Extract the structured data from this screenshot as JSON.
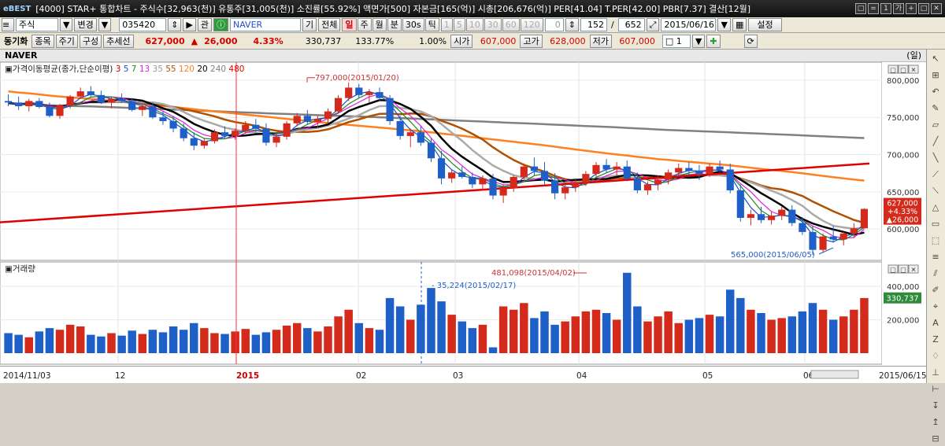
{
  "window": {
    "title": "[4000] STAR+ 통합차트 - 주식수[32,963(천)] 유통주[31,005(천)] 소진률[55.92%] 액면가[500] 자본금[165(억)] 시총[206,676(억)] PER[41.04] T.PER[42.00] PBR[7.37] 결산[12월]",
    "logo": "eBEST",
    "buttons": [
      "□",
      "=",
      "1",
      "가",
      "+",
      "□",
      "✕"
    ]
  },
  "toolbar1": {
    "market": "주식",
    "change": "변경",
    "code": "035420",
    "name": "NAVER",
    "btn_ki": "기",
    "btn_all": "전체",
    "periods": [
      "일",
      "주",
      "월",
      "분",
      "30s",
      "틱"
    ],
    "selected_period": "일",
    "ticks": [
      "1",
      "5",
      "10",
      "30",
      "60",
      "120"
    ],
    "spin_value": "0",
    "count1": "152",
    "count2": "652",
    "date": "2015/06/16",
    "settings": "설정"
  },
  "toolbar2": {
    "sync": "동기화",
    "item": "종목",
    "cycle": "주기",
    "compose": "구성",
    "trend": "추세선",
    "price": "627,000",
    "change_arrow": "▲",
    "change": "26,000",
    "pct": "4.33%",
    "volume": "330,737",
    "vol_ratio": "133.77%",
    "pct2": "1.00%",
    "open_label": "시가",
    "open": "607,000",
    "high_label": "고가",
    "high": "628,000",
    "low_label": "저가",
    "low": "607,000",
    "lines": "1"
  },
  "stock": {
    "name": "NAVER",
    "unit": "(일)"
  },
  "price_panel": {
    "legend_title": "가격이동평균(종가,단순이평)",
    "ma_periods": [
      {
        "p": "3",
        "color": "#d40000"
      },
      {
        "p": "5",
        "color": "#1a4fd8"
      },
      {
        "p": "7",
        "color": "#1a8a1a"
      },
      {
        "p": "13",
        "color": "#e020e0"
      },
      {
        "p": "35",
        "color": "#999999"
      },
      {
        "p": "55",
        "color": "#b05000"
      },
      {
        "p": "120",
        "color": "#ff8020"
      },
      {
        "p": "20",
        "color": "#000000"
      },
      {
        "p": "240",
        "color": "#808080"
      },
      {
        "p": "480",
        "color": "#e00000"
      }
    ],
    "y_ticks": [
      "800,000",
      "750,000",
      "700,000",
      "650,000",
      "600,000"
    ],
    "annot_high": "797,000(2015/01/20)",
    "annot_low": "565,000(2015/06/05)",
    "current_tag": [
      "627,000",
      "+4.33%",
      "▲26,000"
    ]
  },
  "volume_panel": {
    "title": "거래량",
    "y_ticks": [
      "400,000",
      "200,000"
    ],
    "annot_high": "481,098(2015/04/02)",
    "annot_low": "35,224(2015/02/17)",
    "current_tag": "330,737"
  },
  "x_axis": {
    "labels": [
      "2014/11/03",
      "12",
      "2015",
      "02",
      "03",
      "04",
      "05",
      "06",
      "2015/06/15"
    ]
  },
  "colors": {
    "up": "#d42a1c",
    "down": "#1e5fc8",
    "crosshair": "#ff3030"
  },
  "chart_data": {
    "type": "bar",
    "title": "NAVER",
    "xlabel": "",
    "ylabel": "",
    "price_ylim": [
      560000,
      820000
    ],
    "volume_ylim": [
      0,
      480000
    ],
    "candles": [
      [
        772,
        781,
        765,
        770
      ],
      [
        770,
        778,
        760,
        765
      ],
      [
        765,
        775,
        758,
        772
      ],
      [
        772,
        776,
        762,
        764
      ],
      [
        764,
        770,
        750,
        752
      ],
      [
        752,
        768,
        748,
        766
      ],
      [
        766,
        780,
        762,
        778
      ],
      [
        778,
        790,
        775,
        785
      ],
      [
        785,
        792,
        778,
        780
      ],
      [
        780,
        786,
        768,
        770
      ],
      [
        770,
        778,
        762,
        775
      ],
      [
        775,
        782,
        770,
        772
      ],
      [
        772,
        776,
        758,
        760
      ],
      [
        760,
        768,
        752,
        765
      ],
      [
        765,
        770,
        748,
        750
      ],
      [
        750,
        758,
        740,
        745
      ],
      [
        745,
        752,
        730,
        735
      ],
      [
        735,
        742,
        718,
        722
      ],
      [
        722,
        730,
        706,
        712
      ],
      [
        712,
        722,
        708,
        718
      ],
      [
        718,
        734,
        715,
        730
      ],
      [
        730,
        738,
        722,
        725
      ],
      [
        725,
        735,
        720,
        732
      ],
      [
        732,
        745,
        728,
        740
      ],
      [
        740,
        748,
        730,
        735
      ],
      [
        735,
        742,
        712,
        716
      ],
      [
        716,
        728,
        710,
        724
      ],
      [
        724,
        745,
        720,
        742
      ],
      [
        742,
        756,
        738,
        752
      ],
      [
        752,
        760,
        740,
        744
      ],
      [
        744,
        752,
        736,
        748
      ],
      [
        748,
        762,
        742,
        758
      ],
      [
        758,
        780,
        755,
        776
      ],
      [
        776,
        797,
        772,
        790
      ],
      [
        790,
        795,
        776,
        780
      ],
      [
        780,
        788,
        770,
        784
      ],
      [
        784,
        790,
        772,
        776
      ],
      [
        776,
        780,
        740,
        745
      ],
      [
        745,
        752,
        720,
        725
      ],
      [
        725,
        735,
        710,
        730
      ],
      [
        730,
        738,
        712,
        716
      ],
      [
        716,
        722,
        690,
        695
      ],
      [
        695,
        705,
        660,
        668
      ],
      [
        668,
        680,
        662,
        676
      ],
      [
        676,
        684,
        668,
        670
      ],
      [
        670,
        676,
        655,
        660
      ],
      [
        660,
        672,
        652,
        668
      ],
      [
        668,
        674,
        640,
        645
      ],
      [
        645,
        660,
        635,
        655
      ],
      [
        655,
        672,
        650,
        670
      ],
      [
        670,
        688,
        665,
        684
      ],
      [
        684,
        696,
        672,
        678
      ],
      [
        678,
        690,
        660,
        665
      ],
      [
        665,
        675,
        640,
        648
      ],
      [
        648,
        660,
        640,
        656
      ],
      [
        656,
        668,
        650,
        662
      ],
      [
        662,
        678,
        658,
        674
      ],
      [
        674,
        690,
        670,
        686
      ],
      [
        686,
        694,
        676,
        680
      ],
      [
        680,
        690,
        672,
        684
      ],
      [
        684,
        692,
        664,
        668
      ],
      [
        668,
        676,
        648,
        652
      ],
      [
        652,
        664,
        646,
        660
      ],
      [
        660,
        672,
        652,
        666
      ],
      [
        666,
        680,
        660,
        676
      ],
      [
        676,
        688,
        670,
        682
      ],
      [
        682,
        690,
        672,
        678
      ],
      [
        678,
        686,
        666,
        674
      ],
      [
        674,
        688,
        670,
        684
      ],
      [
        684,
        692,
        676,
        680
      ],
      [
        680,
        688,
        648,
        652
      ],
      [
        652,
        660,
        610,
        615
      ],
      [
        615,
        626,
        605,
        620
      ],
      [
        620,
        630,
        608,
        612
      ],
      [
        612,
        624,
        606,
        618
      ],
      [
        618,
        630,
        612,
        626
      ],
      [
        626,
        632,
        604,
        608
      ],
      [
        608,
        616,
        592,
        596
      ],
      [
        596,
        604,
        565,
        572
      ],
      [
        572,
        594,
        568,
        590
      ],
      [
        590,
        604,
        582,
        586
      ],
      [
        586,
        596,
        578,
        594
      ],
      [
        594,
        608,
        588,
        601
      ],
      [
        601,
        628,
        607,
        627
      ]
    ],
    "volume": [
      120,
      110,
      95,
      130,
      150,
      140,
      170,
      160,
      110,
      100,
      120,
      105,
      135,
      115,
      140,
      125,
      160,
      140,
      180,
      150,
      120,
      115,
      130,
      145,
      110,
      125,
      140,
      165,
      180,
      150,
      130,
      160,
      220,
      260,
      180,
      150,
      140,
      330,
      280,
      200,
      290,
      390,
      310,
      230,
      190,
      150,
      170,
      35,
      280,
      260,
      300,
      210,
      250,
      170,
      190,
      220,
      250,
      260,
      240,
      200,
      481,
      280,
      190,
      220,
      250,
      180,
      200,
      210,
      230,
      220,
      380,
      330,
      260,
      240,
      200,
      210,
      220,
      250,
      300,
      260,
      200,
      220,
      260,
      330
    ]
  }
}
